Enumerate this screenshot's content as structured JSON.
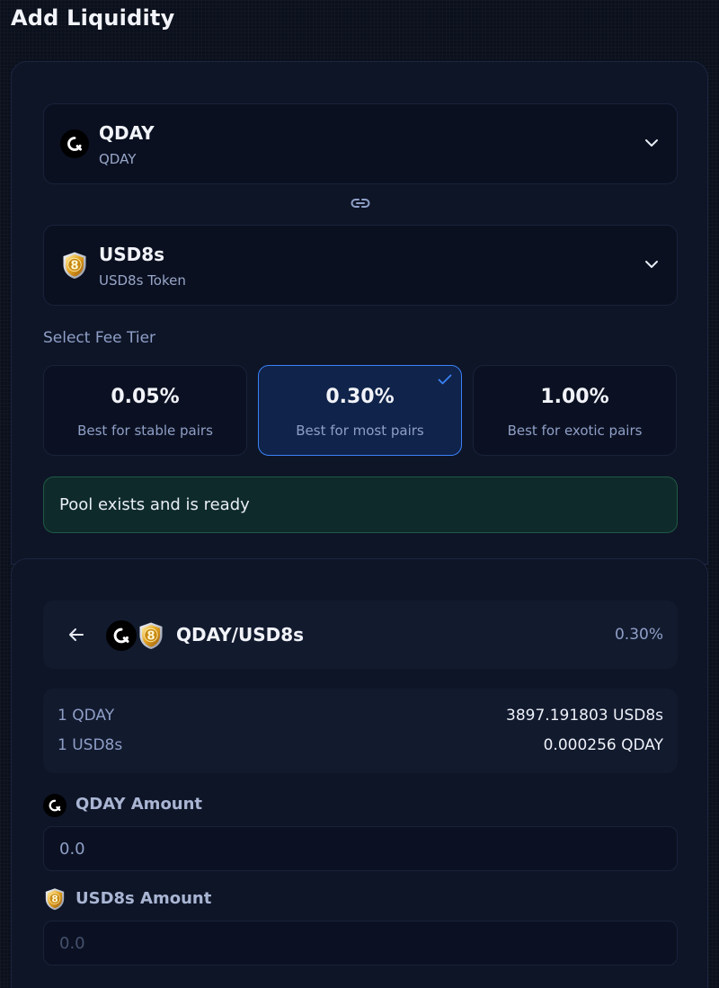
{
  "page": {
    "title": "Add Liquidity"
  },
  "token_a": {
    "symbol": "QDAY",
    "name": "QDAY",
    "icon": "qday-logo-icon"
  },
  "token_b": {
    "symbol": "USD8s",
    "name": "USD8s Token",
    "icon": "usd8s-shield-icon"
  },
  "fee_section": {
    "label": "Select Fee Tier",
    "tiers": [
      {
        "percent": "0.05%",
        "desc": "Best for stable pairs",
        "selected": false
      },
      {
        "percent": "0.30%",
        "desc": "Best for most pairs",
        "selected": true
      },
      {
        "percent": "1.00%",
        "desc": "Best for exotic pairs",
        "selected": false
      }
    ]
  },
  "status": {
    "text": "Pool exists and is ready"
  },
  "pair": {
    "name": "QDAY/USD8s",
    "fee": "0.30%"
  },
  "prices": [
    {
      "label": "1 QDAY",
      "value": "3897.191803 USD8s"
    },
    {
      "label": "1 USD8s",
      "value": "0.000256 QDAY"
    }
  ],
  "amounts": {
    "qday_label": "QDAY Amount",
    "qday_placeholder": "0.0",
    "usd8s_label": "USD8s Amount",
    "usd8s_placeholder": "0.0"
  },
  "colors": {
    "accent": "#3b82f6",
    "background": "#0b101d",
    "status_bg": "#0f2a2a",
    "status_border": "#1f5a44"
  }
}
